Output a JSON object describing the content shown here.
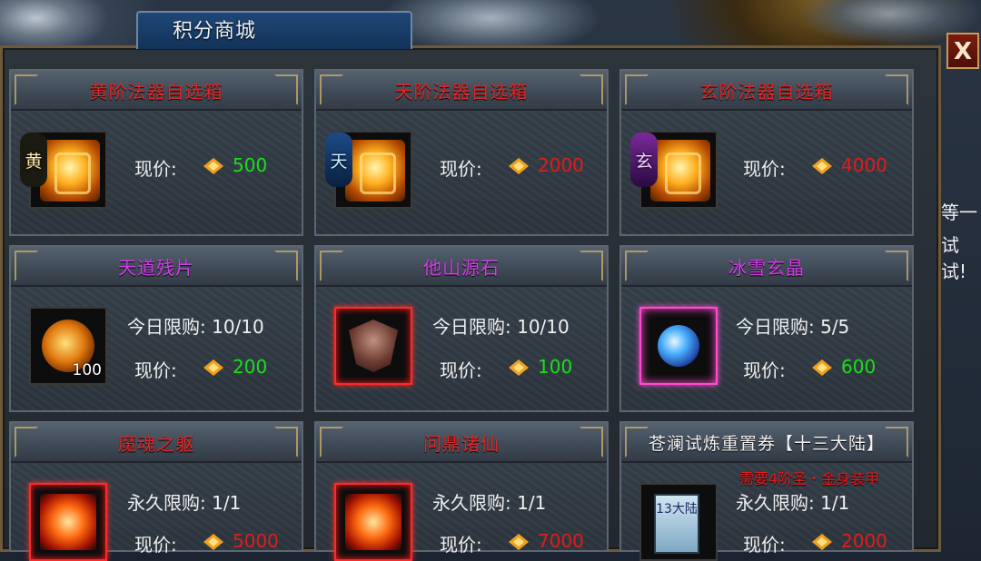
{
  "window": {
    "title": "积分商城",
    "close_label": "X"
  },
  "background_text": {
    "line1": "等一",
    "line2": "试试!"
  },
  "labels": {
    "price": "现价:"
  },
  "cards": [
    {
      "title": "黄阶法器自选箱",
      "title_color": "#e02828",
      "grade": "黄",
      "price": "500",
      "price_color": "#18e018"
    },
    {
      "title": "天阶法器自选箱",
      "title_color": "#e02828",
      "grade": "天",
      "price": "2000",
      "price_color": "#e01c1c"
    },
    {
      "title": "玄阶法器自选箱",
      "title_color": "#e02828",
      "grade": "玄",
      "price": "4000",
      "price_color": "#e01c1c"
    },
    {
      "title": "天道残片",
      "title_color": "#d23ee6",
      "limit": "今日限购: 10/10",
      "quantity": "100",
      "price": "200",
      "price_color": "#18e018"
    },
    {
      "title": "他山源石",
      "title_color": "#d23ee6",
      "limit": "今日限购: 10/10",
      "price": "100",
      "price_color": "#18e018"
    },
    {
      "title": "冰雪玄晶",
      "title_color": "#d23ee6",
      "limit": "今日限购: 5/5",
      "price": "600",
      "price_color": "#18e018"
    },
    {
      "title": "魔魂之躯",
      "title_color": "#e02828",
      "limit": "永久限购: 1/1",
      "price": "5000",
      "price_color": "#e01c1c"
    },
    {
      "title": "问鼎诸仙",
      "title_color": "#e02828",
      "limit": "永久限购: 1/1",
      "price": "7000",
      "price_color": "#e01c1c"
    },
    {
      "title": "苍澜试炼重置券【十三大陆】",
      "title_color": "#f2f2f2",
      "requirement": "需要4阶圣・金身装甲",
      "ticket_text": "13大陆",
      "limit": "永久限购: 1/1",
      "price": "2000",
      "price_color": "#e01c1c"
    }
  ],
  "colors": {
    "accent_gold": "#c7ab6a",
    "price_green": "#18e018",
    "price_red": "#e01c1c"
  }
}
